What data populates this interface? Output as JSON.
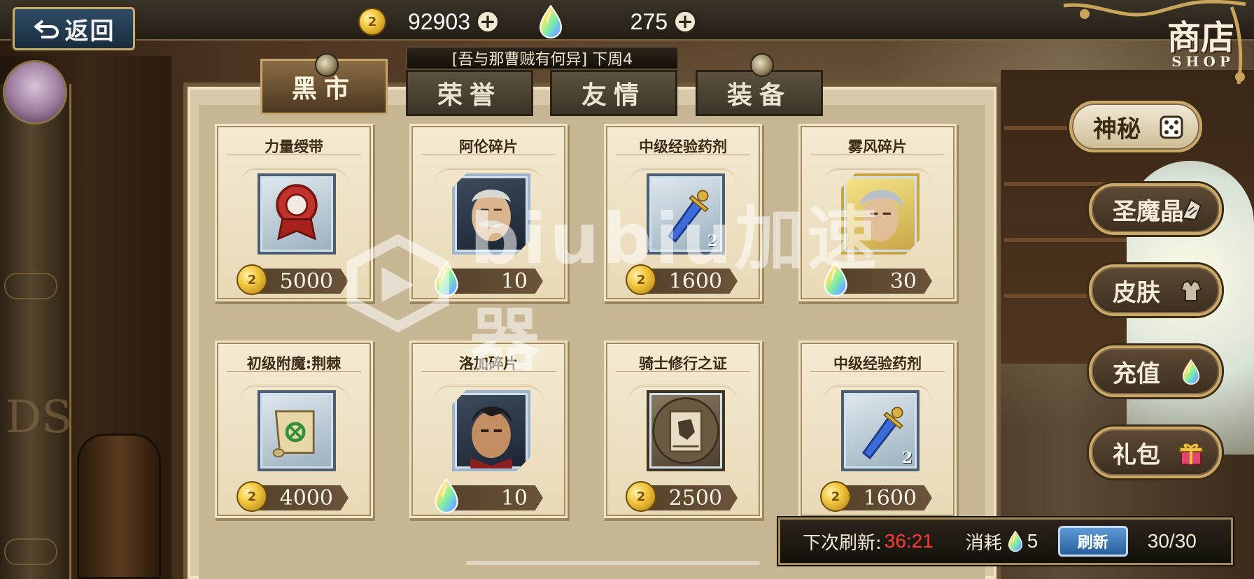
{
  "header": {
    "back_label": "返回",
    "gold": "92903",
    "gems": "275",
    "shop_title_cn": "商店",
    "shop_title_en": "SHOP"
  },
  "event_banner": "[吾与那曹贼有何异] 下周4",
  "tabs": [
    {
      "label": "黑市",
      "active": true
    },
    {
      "label": "荣誉",
      "active": false
    },
    {
      "label": "友情",
      "active": false
    },
    {
      "label": "装备",
      "active": false
    }
  ],
  "items": [
    {
      "name": "力量绶带",
      "icon": "red-sash-icon",
      "currency": "gold",
      "price": "5000"
    },
    {
      "name": "阿伦碎片",
      "icon": "alan-portrait-icon",
      "currency": "gem",
      "price": "10"
    },
    {
      "name": "中级经验药剂",
      "icon": "exp-potion-icon",
      "currency": "gold",
      "price": "1600",
      "stack": "2"
    },
    {
      "name": "雾风碎片",
      "icon": "wufeng-portrait-icon",
      "currency": "gem",
      "price": "30"
    },
    {
      "name": "初级附魔:荆棘",
      "icon": "enchant-scroll-icon",
      "currency": "gold",
      "price": "4000"
    },
    {
      "name": "洛加碎片",
      "icon": "loga-portrait-icon",
      "currency": "gem",
      "price": "10"
    },
    {
      "name": "骑士修行之证",
      "icon": "knight-certificate-icon",
      "currency": "gold",
      "price": "2500"
    },
    {
      "name": "中级经验药剂",
      "icon": "exp-potion-icon",
      "currency": "gold",
      "price": "1600",
      "stack": "2"
    }
  ],
  "side_menu": [
    {
      "label": "神秘",
      "icon": "dice-icon",
      "active": true
    },
    {
      "label": "圣魔晶",
      "icon": "crystal-icon",
      "active": false
    },
    {
      "label": "皮肤",
      "icon": "costume-icon",
      "active": false
    },
    {
      "label": "充值",
      "icon": "gem-icon",
      "active": false
    },
    {
      "label": "礼包",
      "icon": "gift-icon",
      "active": false
    }
  ],
  "refresh": {
    "next_label": "下次刷新:",
    "timer": "36:21",
    "cost_label": "消耗",
    "cost_value": "5",
    "button_label": "刷新",
    "count": "30/30"
  },
  "watermark": "biubiu加速器",
  "colors": {
    "timer_red": "#ff3a35",
    "panel_parchment": "#f4ead2",
    "frame_gold": "#c9a868",
    "refresh_blue": "#2a5e9c"
  }
}
